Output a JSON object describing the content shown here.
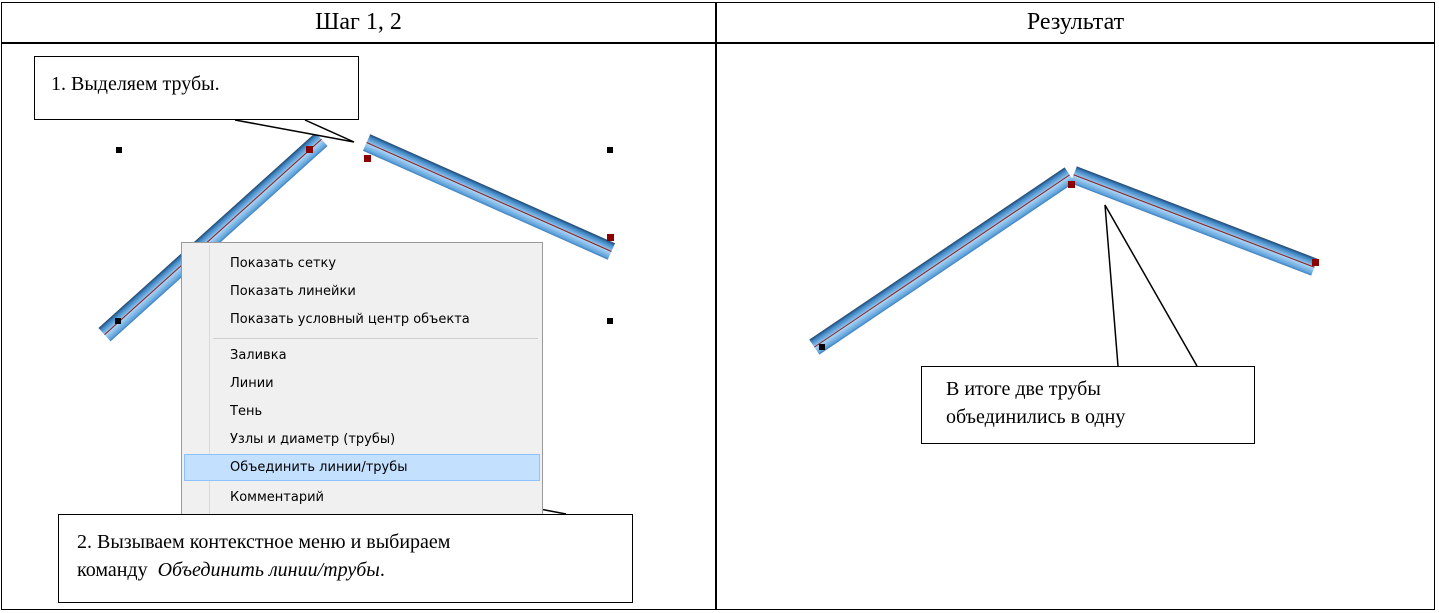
{
  "table": {
    "header_left": "Шаг 1, 2",
    "header_right": "Результат"
  },
  "callouts": {
    "step1": "1. Выделяем трубы.",
    "step2_line1": "2. Вызываем контекстное меню и выбираем",
    "step2_line2_prefix": "команду",
    "step2_line2_italic": "Объединить линии/трубы",
    "step2_line2_suffix": ".",
    "result_line1": "В итоге две трубы",
    "result_line2": "объединились в одну"
  },
  "context_menu": {
    "items": [
      "Показать сетку",
      "Показать линейки",
      "Показать условный центр объекта",
      "Заливка",
      "Линии",
      "Тень",
      "Узлы и диаметр (трубы)",
      "Объединить линии/трубы",
      "Комментарий"
    ],
    "highlighted_index": 7
  },
  "colors": {
    "pipe_dark": "#1c2f4a",
    "pipe_light": "#a9d2f3",
    "pipe_mid": "#3d86c6",
    "pipe_axis": "#8b2020",
    "node_marker": "#8b0000",
    "menu_highlight": "#c4e0ff"
  },
  "icons": {
    "selection_handle": "black-square-handle",
    "pipe_node": "dark-red-square-node"
  }
}
